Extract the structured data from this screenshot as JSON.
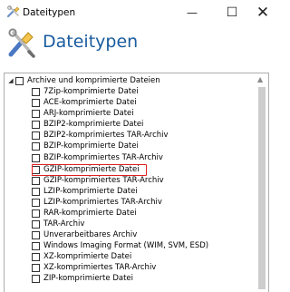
{
  "window": {
    "title": "Dateitypen",
    "minimize_glyph": "—",
    "maximize_glyph": "☐",
    "close_glyph": "✕",
    "app_icon": "tools-icon"
  },
  "header": {
    "title": "Dateitypen",
    "icon": "tools-icon",
    "title_color": "#1a5c9e"
  },
  "tree": {
    "root": {
      "label": "Archive und komprimierte Dateien",
      "expanded": true,
      "checked": false
    },
    "children": [
      "7Zip-komprimierte Datei",
      "ACE-komprimierte Datei",
      "ARJ-komprimierte Datei",
      "BZIP2-komprimierte Datei",
      "BZIP2-komprimiertes TAR-Archiv",
      "BZIP-komprimierte Datei",
      "BZIP-komprimiertes TAR-Archiv",
      "GZIP-komprimierte Datei",
      "GZIP-komprimiertes TAR-Archiv",
      "LZIP-komprimierte Datei",
      "LZIP-komprimiertes TAR-Archiv",
      "RAR-komprimierte Datei",
      "TAR-Archiv",
      "Unverarbeitbares Archiv",
      "Windows Imaging Format (WIM, SVM, ESD)",
      "XZ-komprimierte Datei",
      "XZ-komprimiertes TAR-Archiv",
      "ZIP-komprimierte Datei"
    ],
    "highlighted_child": "GZIP-komprimierte Datei",
    "highlight_color": "#e02020"
  }
}
